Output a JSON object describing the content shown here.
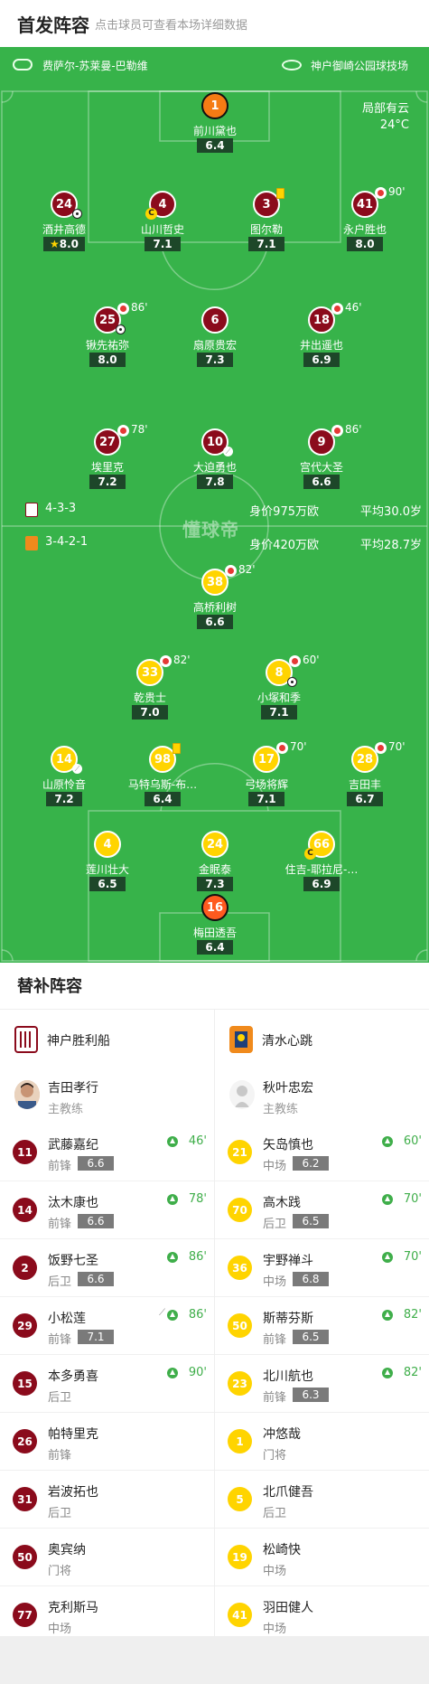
{
  "header": {
    "title": "首发阵容",
    "subtitle": "点击球员可查看本场详细数据"
  },
  "pitch": {
    "referee": "费萨尔-苏莱曼-巴勒维",
    "stadium": "神户御崎公园球技场",
    "weather": "局部有云",
    "temperature": "24°C",
    "watermark": "懂球帝",
    "home_team_row": {
      "formation": "4-3-3",
      "value": "身价975万欧",
      "avg_age": "平均30.0岁"
    },
    "away_team_row": {
      "formation": "3-4-2-1",
      "value": "身价420万欧",
      "avg_age": "平均28.7岁"
    },
    "colors": {
      "pitch": "#37b34a",
      "home": "#8b0b1c",
      "away": "#ffd400",
      "rating_bg": "#1d4729"
    }
  },
  "home_players": [
    {
      "num": "1",
      "name": "前川黛也",
      "rating": "6.4"
    },
    {
      "num": "24",
      "name": "酒井高德",
      "rating": "8.0"
    },
    {
      "num": "4",
      "name": "山川哲史",
      "rating": "7.1"
    },
    {
      "num": "3",
      "name": "图尔勒",
      "rating": "7.1"
    },
    {
      "num": "41",
      "name": "永户胜也",
      "rating": "8.0",
      "sub": "90'"
    },
    {
      "num": "25",
      "name": "锹先祐弥",
      "rating": "8.0",
      "sub": "86'"
    },
    {
      "num": "6",
      "name": "扇原贵宏",
      "rating": "7.3"
    },
    {
      "num": "18",
      "name": "井出遥也",
      "rating": "6.9",
      "sub": "46'"
    },
    {
      "num": "27",
      "name": "埃里克",
      "rating": "7.2",
      "sub": "78'"
    },
    {
      "num": "10",
      "name": "大迫勇也",
      "rating": "7.8"
    },
    {
      "num": "9",
      "name": "宫代大圣",
      "rating": "6.6",
      "sub": "86'"
    }
  ],
  "away_players": [
    {
      "num": "38",
      "name": "高桥利树",
      "rating": "6.6",
      "sub": "82'"
    },
    {
      "num": "33",
      "name": "乾贵士",
      "rating": "7.0",
      "sub": "82'"
    },
    {
      "num": "8",
      "name": "小塚和季",
      "rating": "7.1",
      "sub": "60'"
    },
    {
      "num": "14",
      "name": "山原怜音",
      "rating": "7.2"
    },
    {
      "num": "98",
      "name": "马特乌斯-布…",
      "rating": "6.4"
    },
    {
      "num": "17",
      "name": "弓场将辉",
      "rating": "7.1",
      "sub": "70'"
    },
    {
      "num": "28",
      "name": "吉田丰",
      "rating": "6.7",
      "sub": "70'"
    },
    {
      "num": "4",
      "name": "莲川壮大",
      "rating": "6.5"
    },
    {
      "num": "24",
      "name": "金眠泰",
      "rating": "7.3"
    },
    {
      "num": "66",
      "name": "住吉-耶拉尼-…",
      "rating": "6.9"
    },
    {
      "num": "16",
      "name": "梅田透吾",
      "rating": "6.4"
    }
  ],
  "subs": {
    "title": "替补阵容",
    "home": {
      "team": "神户胜利船",
      "coach": {
        "name": "吉田孝行",
        "role": "主教练"
      },
      "players": [
        {
          "num": "11",
          "name": "武藤嘉纪",
          "pos": "前锋",
          "rating": "6.6",
          "min": "46'"
        },
        {
          "num": "14",
          "name": "汰木康也",
          "pos": "前锋",
          "rating": "6.6",
          "min": "78'"
        },
        {
          "num": "2",
          "name": "饭野七圣",
          "pos": "后卫",
          "rating": "6.6",
          "min": "86'"
        },
        {
          "num": "29",
          "name": "小松莲",
          "pos": "前锋",
          "rating": "7.1",
          "min": "86'"
        },
        {
          "num": "15",
          "name": "本多勇喜",
          "pos": "后卫",
          "rating": "",
          "min": "90'"
        },
        {
          "num": "26",
          "name": "帕特里克",
          "pos": "前锋",
          "rating": "",
          "min": ""
        },
        {
          "num": "31",
          "name": "岩波拓也",
          "pos": "后卫",
          "rating": "",
          "min": ""
        },
        {
          "num": "50",
          "name": "奥宾纳",
          "pos": "门将",
          "rating": "",
          "min": ""
        },
        {
          "num": "77",
          "name": "克利斯马",
          "pos": "中场",
          "rating": "",
          "min": ""
        }
      ]
    },
    "away": {
      "team": "清水心跳",
      "coach": {
        "name": "秋叶忠宏",
        "role": "主教练"
      },
      "players": [
        {
          "num": "21",
          "name": "矢岛慎也",
          "pos": "中场",
          "rating": "6.2",
          "min": "60'"
        },
        {
          "num": "70",
          "name": "高木践",
          "pos": "后卫",
          "rating": "6.5",
          "min": "70'"
        },
        {
          "num": "36",
          "name": "宇野禅斗",
          "pos": "中场",
          "rating": "6.8",
          "min": "70'"
        },
        {
          "num": "50",
          "name": "斯蒂芬斯",
          "pos": "前锋",
          "rating": "6.5",
          "min": "82'"
        },
        {
          "num": "23",
          "name": "北川航也",
          "pos": "前锋",
          "rating": "6.3",
          "min": "82'"
        },
        {
          "num": "1",
          "name": "冲悠哉",
          "pos": "门将",
          "rating": "",
          "min": ""
        },
        {
          "num": "5",
          "name": "北爪健吾",
          "pos": "后卫",
          "rating": "",
          "min": ""
        },
        {
          "num": "19",
          "name": "松崎快",
          "pos": "中场",
          "rating": "",
          "min": ""
        },
        {
          "num": "41",
          "name": "羽田健人",
          "pos": "中场",
          "rating": "",
          "min": ""
        }
      ]
    }
  }
}
